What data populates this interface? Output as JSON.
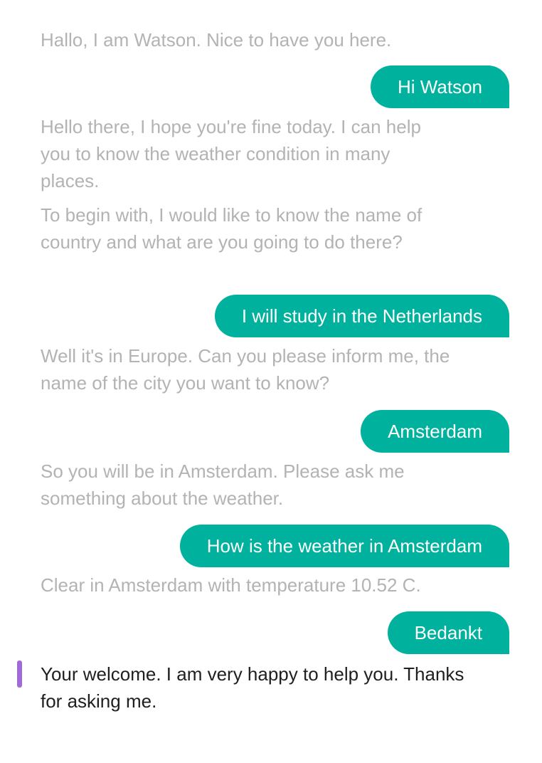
{
  "conversation": {
    "messages": [
      {
        "sender": "watson",
        "text": "Hallo, I am Watson. Nice to have you here."
      },
      {
        "sender": "user",
        "text": "Hi Watson"
      },
      {
        "sender": "watson",
        "text": "Hello there, I hope you're fine today. I can help you to know the weather condition in many places."
      },
      {
        "sender": "watson",
        "text": "To begin with, I would like to know the name of country and what are you going to do there?"
      },
      {
        "sender": "user",
        "text": "I will study in the Netherlands"
      },
      {
        "sender": "watson",
        "text": "Well it's in Europe. Can you please inform me, the name of the city you want to know?"
      },
      {
        "sender": "user",
        "text": "Amsterdam"
      },
      {
        "sender": "watson",
        "text": "So you will be in Amsterdam. Please ask me something about the weather."
      },
      {
        "sender": "user",
        "text": "How is the weather in Amsterdam"
      },
      {
        "sender": "watson",
        "text": "Clear in Amsterdam with temperature 10.52 C."
      },
      {
        "sender": "user",
        "text": "Bedankt"
      },
      {
        "sender": "watson",
        "text": "Your welcome. I am very happy to help you. Thanks for asking me."
      }
    ]
  },
  "colors": {
    "user_bubble": "#00b19d",
    "watson_text": "#b3b3b3",
    "latest_text": "#1f1f1f",
    "cursor": "#a06ad9"
  }
}
